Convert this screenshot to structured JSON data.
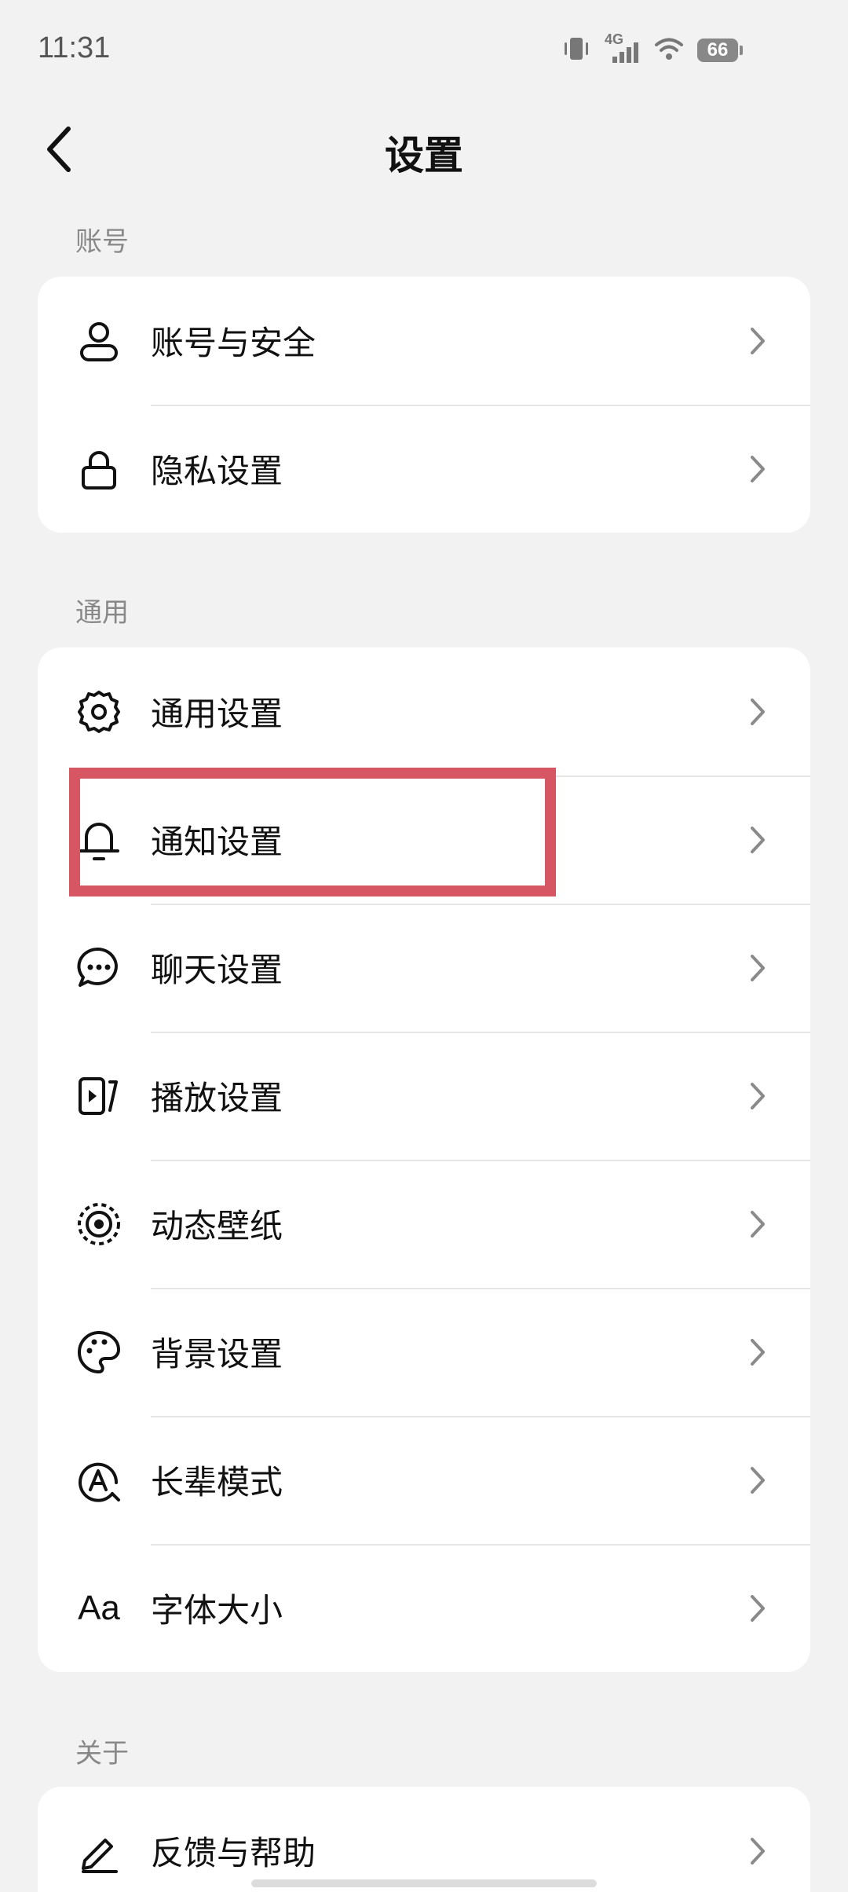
{
  "status_bar": {
    "time": "11:31",
    "network": "4G",
    "battery": "66"
  },
  "header": {
    "title": "设置",
    "back_icon": "chevron-left-icon"
  },
  "sections": [
    {
      "label": "账号",
      "items": [
        {
          "label": "账号与安全",
          "icon": "person-icon"
        },
        {
          "label": "隐私设置",
          "icon": "lock-icon"
        }
      ]
    },
    {
      "label": "通用",
      "items": [
        {
          "label": "通用设置",
          "icon": "gear-icon"
        },
        {
          "label": "通知设置",
          "icon": "bell-icon"
        },
        {
          "label": "聊天设置",
          "icon": "chat-bubble-icon"
        },
        {
          "label": "播放设置",
          "icon": "play-video-icon"
        },
        {
          "label": "动态壁纸",
          "icon": "live-wallpaper-icon"
        },
        {
          "label": "背景设置",
          "icon": "palette-icon"
        },
        {
          "label": "长辈模式",
          "icon": "elder-mode-icon"
        },
        {
          "label": "字体大小",
          "icon": "font-size-icon",
          "glyph": "Aa"
        }
      ]
    },
    {
      "label": "关于",
      "items": [
        {
          "label": "反馈与帮助",
          "icon": "pencil-icon"
        }
      ]
    }
  ],
  "colors": {
    "background": "#f2f2f2",
    "card": "#ffffff",
    "highlight": "#d65663",
    "chevron": "#8a8a8a"
  }
}
